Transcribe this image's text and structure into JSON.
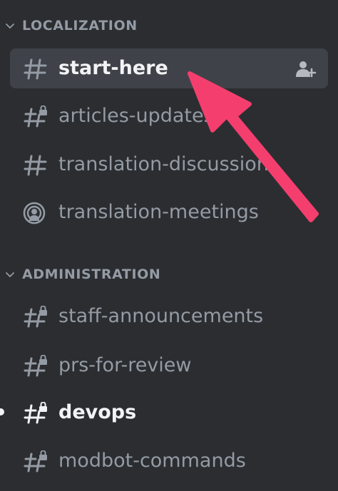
{
  "categories": [
    {
      "label": "LOCALIZATION",
      "channels": [
        {
          "label": "start-here",
          "icon": "hash-icon"
        },
        {
          "label": "articles-updates",
          "icon": "hash-lock-icon"
        },
        {
          "label": "translation-discussion",
          "icon": "hash-icon"
        },
        {
          "label": "translation-meetings",
          "icon": "stage-icon"
        }
      ]
    },
    {
      "label": "ADMINISTRATION",
      "channels": [
        {
          "label": "staff-announcements",
          "icon": "hash-lock-icon"
        },
        {
          "label": "prs-for-review",
          "icon": "hash-lock-icon"
        },
        {
          "label": "devops",
          "icon": "hash-lock-icon"
        },
        {
          "label": "modbot-commands",
          "icon": "hash-lock-icon"
        }
      ]
    }
  ],
  "selected_channel": "start-here",
  "unread_channel": "devops",
  "colors": {
    "background": "#2b2d31",
    "selected_background": "#404249",
    "muted_text": "#949ba4",
    "active_text": "#f2f3f5",
    "arrow": "#f43f6e"
  }
}
